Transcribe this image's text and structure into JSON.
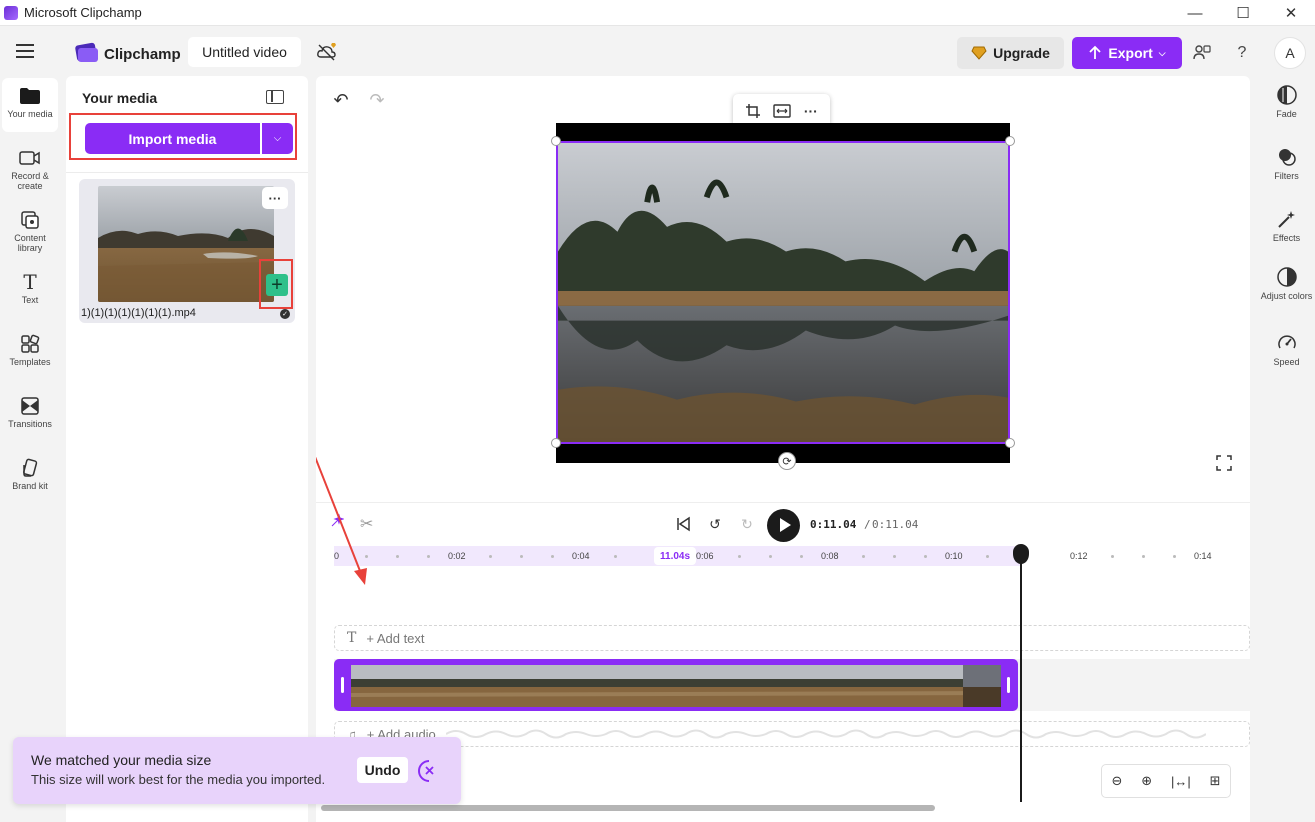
{
  "window": {
    "title": "Microsoft Clipchamp",
    "controls": [
      "—",
      "☐",
      "✕"
    ]
  },
  "header": {
    "brand": "Clipchamp",
    "video_title": "Untitled video",
    "upgrade_label": "Upgrade",
    "export_label": "Export",
    "avatar_initial": "A",
    "help_glyph": "?"
  },
  "leftnav": {
    "items": [
      {
        "label": "Your media",
        "icon": "folder-icon"
      },
      {
        "label": "Record & create",
        "icon": "camera-icon"
      },
      {
        "label": "Content library",
        "icon": "library-icon"
      },
      {
        "label": "Text",
        "icon": "text-icon"
      },
      {
        "label": "Templates",
        "icon": "templates-icon"
      },
      {
        "label": "Transitions",
        "icon": "transitions-icon"
      },
      {
        "label": "Brand kit",
        "icon": "brand-kit-icon"
      }
    ]
  },
  "media_panel": {
    "title": "Your media",
    "import_label": "Import media",
    "file_name": "1)(1)(1)(1)(1)(1)(1).mp4"
  },
  "playback": {
    "current_time": "0:11.04",
    "separator": "/",
    "total_time": "0:11.04",
    "marker_label": "11.04s"
  },
  "ruler": {
    "labels": [
      "0",
      "0:02",
      "0:04",
      "0:06",
      "0:08",
      "0:10",
      "0:12",
      "0:14"
    ]
  },
  "tracks": {
    "add_text": "+ Add text",
    "add_audio": "+ Add audio"
  },
  "toast": {
    "title": "We matched your media size",
    "text": "This size will work best for the media you imported.",
    "undo_label": "Undo"
  },
  "rightnav": {
    "items": [
      {
        "label": "Fade",
        "icon": "fade-icon"
      },
      {
        "label": "Filters",
        "icon": "filters-icon"
      },
      {
        "label": "Effects",
        "icon": "effects-icon"
      },
      {
        "label": "Adjust colors",
        "icon": "adjust-colors-icon"
      },
      {
        "label": "Speed",
        "icon": "speed-icon"
      }
    ]
  },
  "colors": {
    "accent": "#8a2cf5",
    "highlight": "#e8413a",
    "add_button": "#2ec08a"
  }
}
